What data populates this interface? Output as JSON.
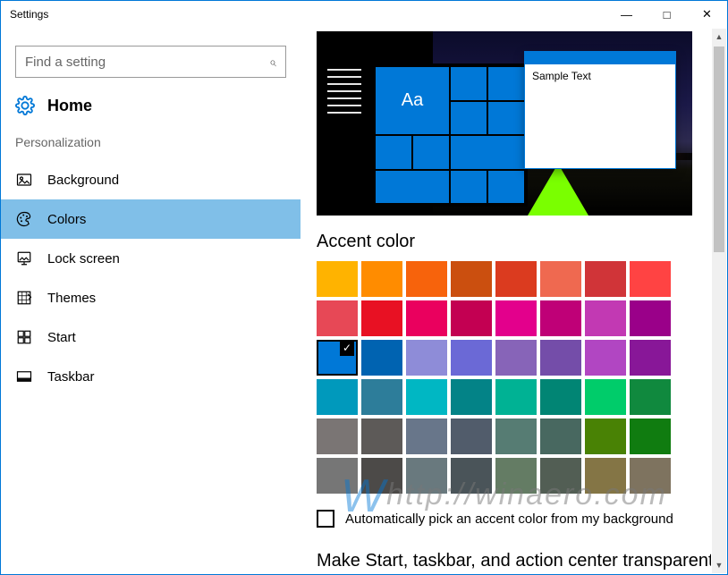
{
  "window": {
    "title": "Settings"
  },
  "search": {
    "placeholder": "Find a setting"
  },
  "home": {
    "label": "Home"
  },
  "section": {
    "label": "Personalization"
  },
  "nav": {
    "items": [
      {
        "label": "Background"
      },
      {
        "label": "Colors"
      },
      {
        "label": "Lock screen"
      },
      {
        "label": "Themes"
      },
      {
        "label": "Start"
      },
      {
        "label": "Taskbar"
      }
    ],
    "active_index": 1
  },
  "preview": {
    "tile_text": "Aa",
    "sample_text": "Sample Text"
  },
  "accent": {
    "heading": "Accent color",
    "selected_index": 16,
    "colors": [
      "#ffb300",
      "#ff8c00",
      "#f7630c",
      "#cb4f0f",
      "#db3b1f",
      "#ef6950",
      "#d03438",
      "#ff4343",
      "#e74856",
      "#e81123",
      "#ea005e",
      "#c30052",
      "#e3008c",
      "#bf0077",
      "#c239b3",
      "#9a0089",
      "#0078d7",
      "#0063b1",
      "#8e8cd8",
      "#6b69d6",
      "#8764b8",
      "#744da9",
      "#b146c2",
      "#881798",
      "#0099bc",
      "#2d7d9a",
      "#00b7c3",
      "#038387",
      "#00b294",
      "#018574",
      "#00cc6a",
      "#10893e",
      "#7a7574",
      "#5d5a58",
      "#68768a",
      "#515c6b",
      "#567c73",
      "#486860",
      "#498205",
      "#107c10",
      "#767676",
      "#4c4a48",
      "#69797e",
      "#4a5459",
      "#647c64",
      "#525e54",
      "#847545",
      "#7e735f"
    ]
  },
  "auto_checkbox": {
    "label": "Automatically pick an accent color from my background"
  },
  "next_heading": {
    "text": "Make Start, taskbar, and action center transparent"
  },
  "watermark": {
    "text": "http://winaero.com"
  }
}
